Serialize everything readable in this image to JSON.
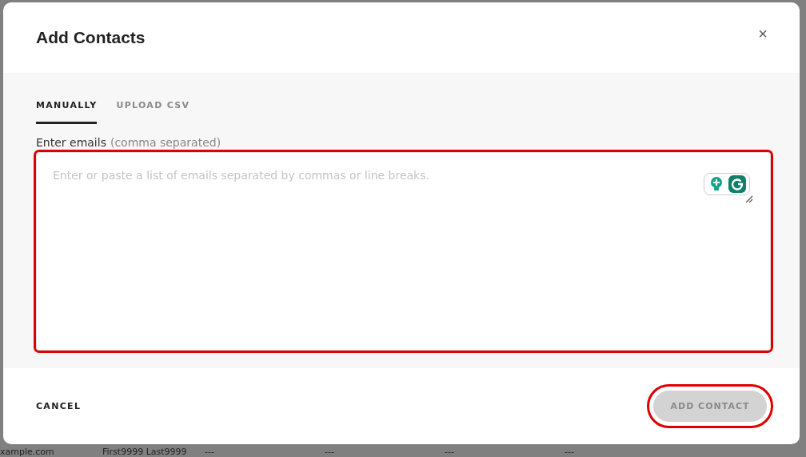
{
  "background": {
    "row": [
      "xample.com",
      "First9999 Last9999",
      "---",
      "---",
      "---",
      "---"
    ]
  },
  "dialog": {
    "title": "Add Contacts",
    "close": "×",
    "tabs": [
      {
        "label": "MANUALLY",
        "selected": true
      },
      {
        "label": "UPLOAD CSV",
        "selected": false
      }
    ],
    "field": {
      "label": "Enter emails",
      "hint": "(comma separated)",
      "placeholder": "Enter or paste a list of emails separated by commas or line breaks."
    },
    "cancel": "CANCEL",
    "submit": {
      "label": "ADD CONTACT",
      "disabled": true
    }
  }
}
